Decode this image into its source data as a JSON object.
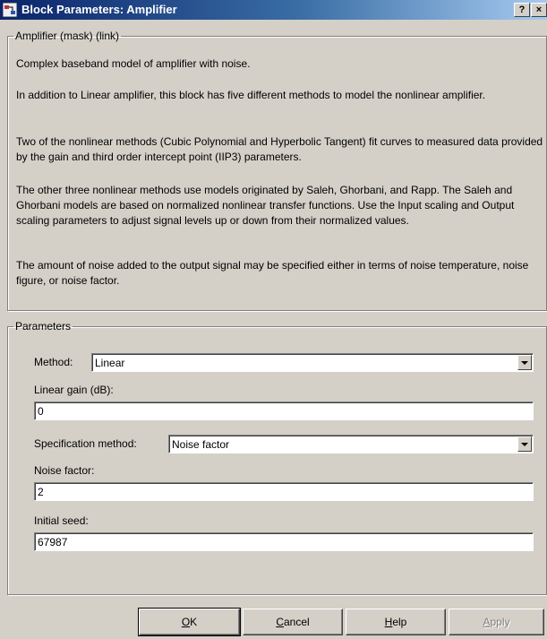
{
  "window": {
    "title": "Block Parameters: Amplifier",
    "help_button": "?",
    "close_button": "×"
  },
  "mask_group": {
    "legend": "Amplifier (mask) (link)",
    "paragraphs": [
      "Complex baseband model of amplifier with noise.",
      "In addition to Linear amplifier, this block has five different methods to model the nonlinear amplifier.",
      "Two of the nonlinear methods (Cubic Polynomial and Hyperbolic Tangent) fit curves to measured data provided by the gain and third order intercept point (IIP3) parameters.",
      "The other three nonlinear methods use models originated by Saleh, Ghorbani, and Rapp.  The Saleh and Ghorbani models are based on normalized nonlinear transfer functions.  Use the Input scaling and Output scaling parameters to adjust signal levels up or down from their normalized values.",
      "The amount of noise added to the output signal may be specified either in terms of noise temperature, noise figure, or noise factor."
    ]
  },
  "params_group": {
    "legend": "Parameters",
    "method_label": "Method:",
    "method_value": "Linear",
    "linear_gain_label": "Linear gain (dB):",
    "linear_gain_value": "0",
    "spec_method_label": "Specification method:",
    "spec_method_value": "Noise factor",
    "noise_factor_label": "Noise factor:",
    "noise_factor_value": "2",
    "initial_seed_label": "Initial seed:",
    "initial_seed_value": "67987"
  },
  "buttons": {
    "ok": {
      "accel": "O",
      "rest": "K"
    },
    "cancel": {
      "accel": "C",
      "rest": "ancel"
    },
    "help": {
      "accel": "H",
      "rest": "elp"
    },
    "apply": {
      "accel": "A",
      "rest": "pply",
      "enabled": false
    }
  },
  "colors": {
    "title_gradient_start": "#0a246a",
    "title_gradient_end": "#a6caf0",
    "dialog_face": "#d4d0c8"
  }
}
